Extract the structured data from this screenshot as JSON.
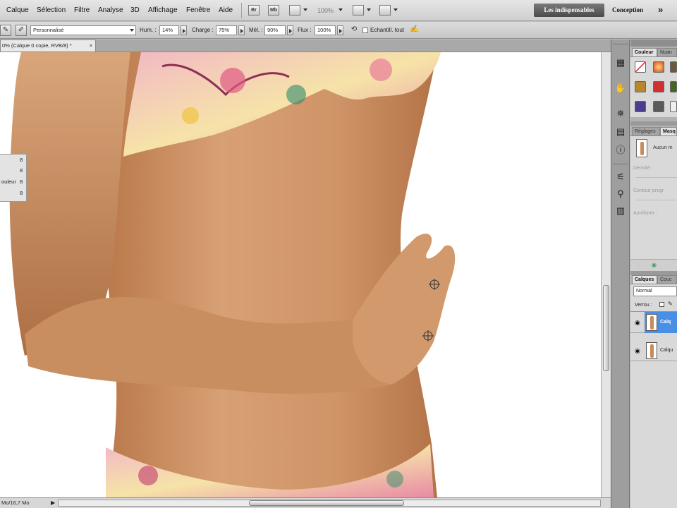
{
  "menubar": {
    "items": [
      "Calque",
      "Sélection",
      "Filtre",
      "Analyse",
      "3D",
      "Affichage",
      "Fenêtre",
      "Aide"
    ],
    "icon_br": "Br",
    "icon_mb": "Mb",
    "zoom": "100%",
    "workspace_active": "Les indispensables",
    "workspace_design": "Conception",
    "more": "»"
  },
  "options": {
    "preset": "Personnalisé",
    "hum_label": "Hum. :",
    "hum_value": "14%",
    "charge_label": "Charge :",
    "charge_value": "75%",
    "mel_label": "Mél. :",
    "mel_value": "90%",
    "flux_label": "Flux :",
    "flux_value": "100%",
    "sample_all": "Echantill. tout"
  },
  "document": {
    "tab_title": "0% (Calque 0 copie, RVB/8) *",
    "close": "×",
    "status": "Mo/16,7 Mo"
  },
  "floatpanel": {
    "rows": [
      {
        "label": "",
        "value": "8"
      },
      {
        "label": "",
        "value": "8"
      },
      {
        "label": "ouleur",
        "value": "8"
      },
      {
        "label": "",
        "value": "8"
      }
    ]
  },
  "panels": {
    "color_tab": "Couleur",
    "swatches_tab": "Nuan",
    "adjust_tab": "Réglages",
    "masks_tab": "Masq",
    "mask_none": "Aucun m",
    "density": "Densité :",
    "feather": "Contour progr",
    "refine": "Améliorer :",
    "layers_tab": "Calques",
    "channels_tab": "Couc",
    "blend_mode": "Normal",
    "lock": "Verrou :",
    "layers": [
      {
        "name": "Calq",
        "selected": true
      },
      {
        "name": "Calqu",
        "selected": false
      }
    ]
  },
  "icons": {
    "brush": "brush-icon",
    "swatch": "swatch-icon",
    "layers": "layers-icon"
  }
}
